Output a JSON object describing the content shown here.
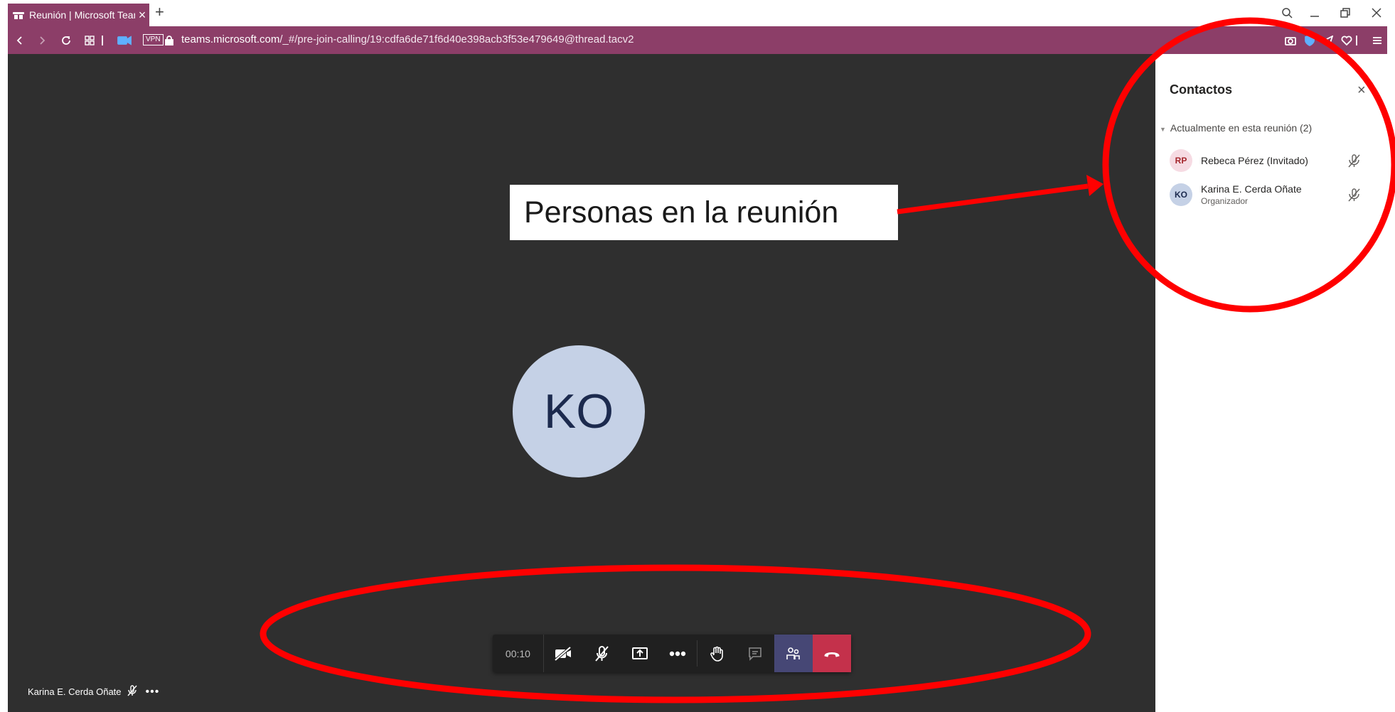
{
  "browser": {
    "tab_title": "Reunión | Microsoft Teams",
    "url_host": "teams.microsoft.com",
    "url_path": "/_#/pre-join-calling/19:cdfa6de71f6d40e398acb3f53e479649@thread.tacv2",
    "vpn_label": "VPN",
    "accent_color": "#8c3e68"
  },
  "stage": {
    "avatar_initials": "KO",
    "callout_text": "Personas en la reunión",
    "self_name": "Karina E. Cerda Oñate"
  },
  "toolbar": {
    "timer": "00:10",
    "buttons": [
      "camera-off-icon",
      "mic-off-icon",
      "share-screen-icon",
      "more-icon",
      "raise-hand-icon",
      "chat-icon",
      "participants-icon",
      "hang-up-icon"
    ]
  },
  "panel": {
    "title": "Contactos",
    "group_label": "Actualmente en esta reunión (2)",
    "participants": [
      {
        "initials": "RP",
        "name": "Rebeca Pérez (Invitado)",
        "role": "",
        "avatar_color": "#f6dbe3",
        "initials_color": "#a4262c"
      },
      {
        "initials": "KO",
        "name": "Karina E. Cerda Oñate",
        "role": "Organizador",
        "avatar_color": "#c5d1e6",
        "initials_color": "#1c2a4e"
      }
    ]
  },
  "colors": {
    "stage_bg": "#2f2f2f",
    "hangup": "#c4314b",
    "people_active": "#464775",
    "annotation_red": "#ff0000"
  }
}
